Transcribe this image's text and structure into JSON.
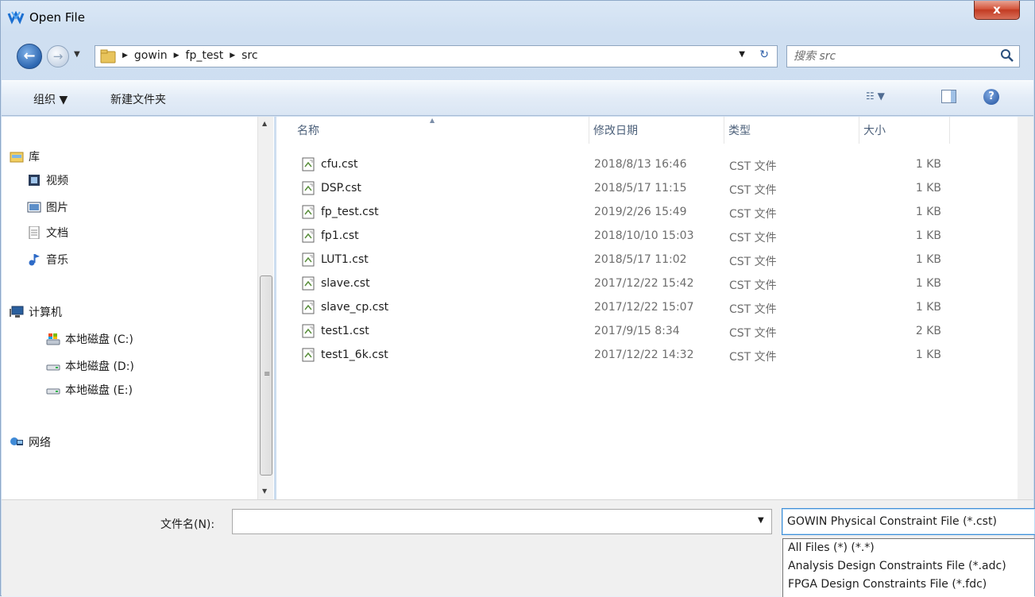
{
  "window": {
    "title": "Open File",
    "close_glyph": "x"
  },
  "address": {
    "crumbs": [
      "gowin",
      "fp_test",
      "src"
    ],
    "search_placeholder": "搜索 src"
  },
  "toolbar": {
    "organize": "组织 ▼",
    "new_folder": "新建文件夹",
    "view_glyph": "☷ ▼",
    "help_glyph": "?"
  },
  "nav": {
    "libraries": "库",
    "videos": "视频",
    "pictures": "图片",
    "documents": "文档",
    "music": "音乐",
    "computer": "计算机",
    "disk_c": "本地磁盘 (C:)",
    "disk_d": "本地磁盘 (D:)",
    "disk_e": "本地磁盘 (E:)",
    "network": "网络"
  },
  "columns": {
    "name": "名称",
    "date": "修改日期",
    "type": "类型",
    "size": "大小"
  },
  "files": [
    {
      "name": "cfu.cst",
      "date": "2018/8/13 16:46",
      "type": "CST 文件",
      "size": "1 KB"
    },
    {
      "name": "DSP.cst",
      "date": "2018/5/17 11:15",
      "type": "CST 文件",
      "size": "1 KB"
    },
    {
      "name": "fp_test.cst",
      "date": "2019/2/26 15:49",
      "type": "CST 文件",
      "size": "1 KB"
    },
    {
      "name": "fp1.cst",
      "date": "2018/10/10 15:03",
      "type": "CST 文件",
      "size": "1 KB"
    },
    {
      "name": "LUT1.cst",
      "date": "2018/5/17 11:02",
      "type": "CST 文件",
      "size": "1 KB"
    },
    {
      "name": "slave.cst",
      "date": "2017/12/22 15:42",
      "type": "CST 文件",
      "size": "1 KB"
    },
    {
      "name": "slave_cp.cst",
      "date": "2017/12/22 15:07",
      "type": "CST 文件",
      "size": "1 KB"
    },
    {
      "name": "test1.cst",
      "date": "2017/9/15 8:34",
      "type": "CST 文件",
      "size": "2 KB"
    },
    {
      "name": "test1_6k.cst",
      "date": "2017/12/22 14:32",
      "type": "CST 文件",
      "size": "1 KB"
    }
  ],
  "bottom": {
    "filename_label": "文件名(N):",
    "filename_value": "",
    "filetype_selected": "GOWIN Physical Constraint File (*.cst)",
    "filetype_options": [
      "All Files (*) (*.*)",
      "Analysis Design Constraints File (*.adc)",
      "FPGA Design Constraints File (*.fdc)"
    ]
  }
}
